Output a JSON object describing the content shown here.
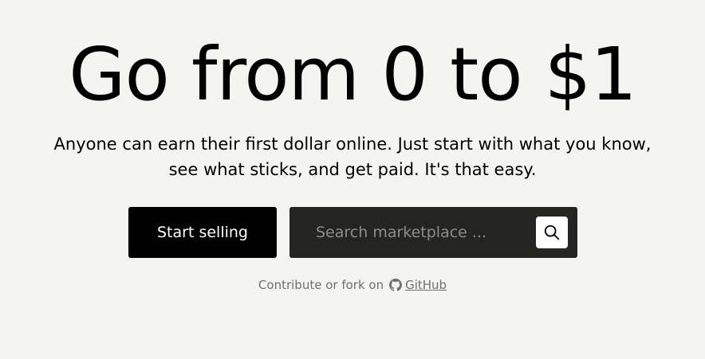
{
  "hero": {
    "title": "Go from 0 to $1",
    "subtitle": "Anyone can earn their first dollar online. Just start with what you know, see what sticks, and get paid. It's that easy."
  },
  "cta": {
    "start_label": "Start selling"
  },
  "search": {
    "placeholder": "Search marketplace ...",
    "value": "",
    "button_icon": "search-icon"
  },
  "footer": {
    "prefix": "Contribute or fork on",
    "link_label": "GitHub",
    "link_icon": "github-icon"
  },
  "colors": {
    "background": "#f4f4f0",
    "primary_button": "#000000",
    "search_box": "#242423",
    "muted_text": "#6f6f6c"
  }
}
